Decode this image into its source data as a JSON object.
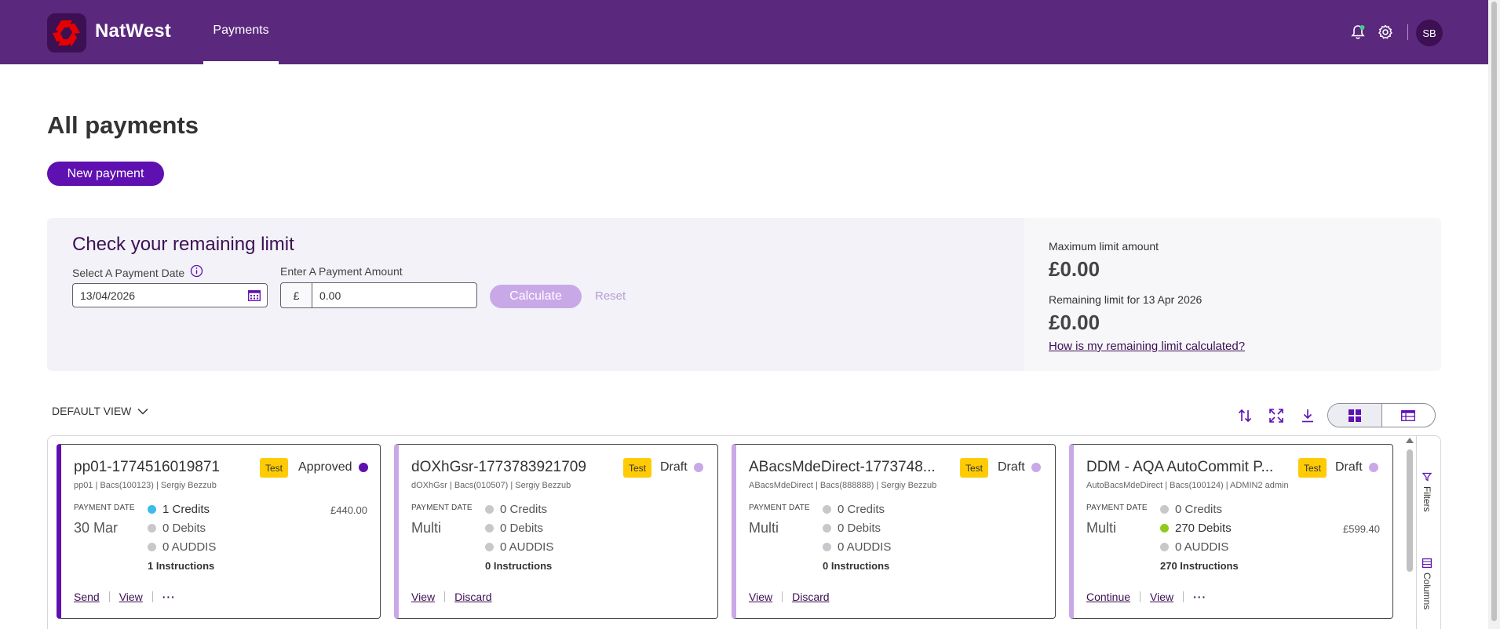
{
  "header": {
    "brand": "NatWest",
    "nav_tab": "Payments",
    "avatar_initials": "SB",
    "bg_color": "#5a287d"
  },
  "page": {
    "title": "All payments",
    "new_payment_label": "New payment"
  },
  "limit": {
    "title": "Check your remaining limit",
    "date_label": "Select A Payment Date",
    "date_value": "13/04/2026",
    "amount_label": "Enter A Payment Amount",
    "currency_symbol": "£",
    "amount_value": "0.00",
    "calculate_label": "Calculate",
    "reset_label": "Reset",
    "max_label": "Maximum limit amount",
    "max_value": "£0.00",
    "remaining_label": "Remaining limit for 13 Apr 2026",
    "remaining_value": "£0.00",
    "help_link": "How is my remaining limit calculated?"
  },
  "view": {
    "selected": "DEFAULT VIEW"
  },
  "side": {
    "filters_label": "Filters",
    "columns_label": "Columns"
  },
  "common": {
    "payment_date_label": "PAYMENT DATE",
    "test_badge": "Test"
  },
  "cards": [
    {
      "title": "pp01-1774516019871",
      "subtitle": "pp01 | Bacs(100123) | Sergiy Bezzub",
      "status": "Approved",
      "date": "30 Mar",
      "credits": "1 Credits",
      "debits": "0 Debits",
      "auddis": "0 AUDDIS",
      "instructions": "1 Instructions",
      "amount": "£440.00",
      "actions": [
        "Send",
        "View"
      ]
    },
    {
      "title": "dOXhGsr-1773783921709",
      "subtitle": "dOXhGsr | Bacs(010507) | Sergiy Bezzub",
      "status": "Draft",
      "date": "Multi",
      "credits": "0 Credits",
      "debits": "0 Debits",
      "auddis": "0 AUDDIS",
      "instructions": "0 Instructions",
      "actions": [
        "View",
        "Discard"
      ]
    },
    {
      "title": "ABacsMdeDirect-1773748...",
      "subtitle": "ABacsMdeDirect | Bacs(888888) | Sergiy Bezzub",
      "status": "Draft",
      "date": "Multi",
      "credits": "0 Credits",
      "debits": "0 Debits",
      "auddis": "0 AUDDIS",
      "instructions": "0 Instructions",
      "actions": [
        "View",
        "Discard"
      ]
    },
    {
      "title": "DDM - AQA AutoCommit P...",
      "subtitle": "AutoBacsMdeDirect | Bacs(100124) | ADMIN2 admin",
      "status": "Draft",
      "date": "Multi",
      "credits": "0 Credits",
      "debits": "270 Debits",
      "auddis": "0 AUDDIS",
      "instructions": "270 Instructions",
      "amount": "£599.40",
      "actions": [
        "Continue",
        "View"
      ]
    }
  ],
  "colors": {
    "primary": "#5e10b1",
    "approved_dot": "#5e10b1",
    "draft_dot": "#c9a8e8",
    "credit_dot": "#3cbce8",
    "debit_dot": "#8ecc1a",
    "badge": "#ffcb05"
  }
}
